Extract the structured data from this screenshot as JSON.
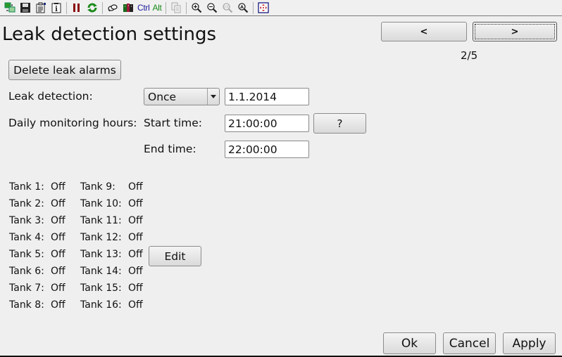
{
  "toolbar": {
    "items": [
      {
        "name": "connect-icon",
        "type": "icon"
      },
      {
        "name": "save-icon",
        "type": "icon"
      },
      {
        "name": "properties-icon",
        "type": "icon"
      },
      {
        "name": "info-icon",
        "type": "icon"
      },
      {
        "type": "separator"
      },
      {
        "name": "pause-icon",
        "type": "icon"
      },
      {
        "name": "refresh-icon",
        "type": "icon"
      },
      {
        "type": "separator"
      },
      {
        "name": "keys-icon",
        "type": "icon"
      },
      {
        "name": "book-icon",
        "type": "icon"
      },
      {
        "name": "ctrl-key",
        "type": "text",
        "label": "Ctrl",
        "color": "#1a1aa0"
      },
      {
        "name": "alt-key",
        "type": "text",
        "label": "Alt",
        "color": "#1a8a1a"
      },
      {
        "type": "separator"
      },
      {
        "name": "copy-icon",
        "type": "icon",
        "disabled": true
      },
      {
        "type": "separator"
      },
      {
        "name": "zoom-in-icon",
        "type": "icon"
      },
      {
        "name": "zoom-out-icon",
        "type": "icon"
      },
      {
        "name": "zoom-100-icon",
        "type": "icon",
        "disabled": true
      },
      {
        "name": "zoom-auto-icon",
        "type": "icon"
      },
      {
        "type": "separator"
      },
      {
        "name": "fit-screen-icon",
        "type": "icon"
      }
    ]
  },
  "page": {
    "title": "Leak detection settings",
    "prev_label": "<",
    "next_label": ">",
    "page_indicator": "2/5"
  },
  "actions": {
    "delete_alarms_label": "Delete leak alarms",
    "help_label": "?",
    "edit_label": "Edit",
    "ok_label": "Ok",
    "cancel_label": "Cancel",
    "apply_label": "Apply"
  },
  "form": {
    "leak_detection_label": "Leak detection:",
    "leak_detection_mode": "Once",
    "leak_detection_date": "1.1.2014",
    "daily_hours_label": "Daily monitoring hours:",
    "start_time_label": "Start time:",
    "start_time": "21:00:00",
    "end_time_label": "End time:",
    "end_time": "22:00:00"
  },
  "tanks": [
    {
      "label": "Tank 1:",
      "status": "Off"
    },
    {
      "label": "Tank 2:",
      "status": "Off"
    },
    {
      "label": "Tank 3:",
      "status": "Off"
    },
    {
      "label": "Tank 4:",
      "status": "Off"
    },
    {
      "label": "Tank 5:",
      "status": "Off"
    },
    {
      "label": "Tank 6:",
      "status": "Off"
    },
    {
      "label": "Tank 7:",
      "status": "Off"
    },
    {
      "label": "Tank 8:",
      "status": "Off"
    },
    {
      "label": "Tank 9:",
      "status": "Off"
    },
    {
      "label": "Tank 10:",
      "status": "Off"
    },
    {
      "label": "Tank 11:",
      "status": "Off"
    },
    {
      "label": "Tank 12:",
      "status": "Off"
    },
    {
      "label": "Tank 13:",
      "status": "Off"
    },
    {
      "label": "Tank 14:",
      "status": "Off"
    },
    {
      "label": "Tank 15:",
      "status": "Off"
    },
    {
      "label": "Tank 16:",
      "status": "Off"
    }
  ]
}
